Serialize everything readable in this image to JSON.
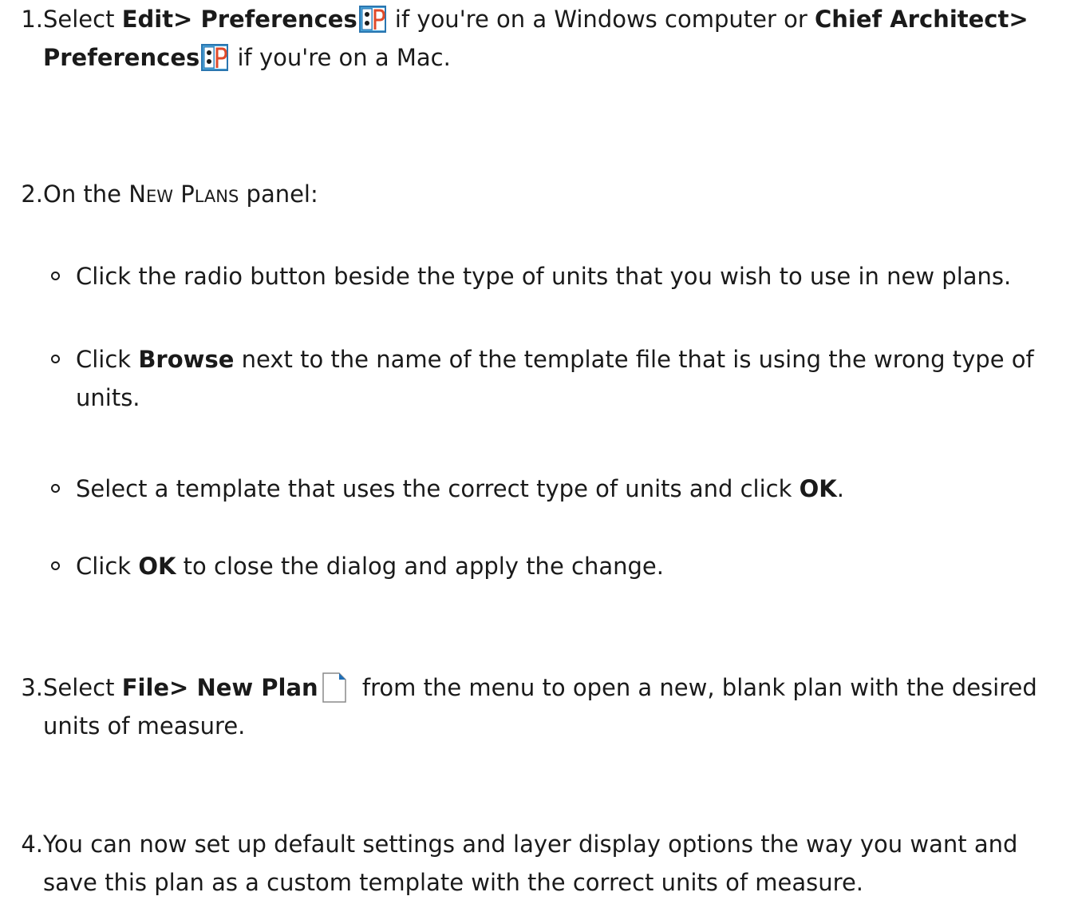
{
  "steps": [
    {
      "num": "1.",
      "pre": "Select ",
      "menu1": "Edit> Preferences",
      "mid1": " if you're on a Windows computer or ",
      "menu2": "Chief Architect> Preferences",
      "post": " if you're on a Mac."
    },
    {
      "num": "2.",
      "pre": "On the ",
      "panel_cap1": "N",
      "panel_small1": "EW",
      "panel_cap2": " P",
      "panel_small2": "LANS",
      "post": " panel:",
      "subitems": [
        {
          "text": "Click the radio button beside the type of units that you wish to use in new plans."
        },
        {
          "pre": "Click ",
          "bold": "Browse",
          "post": " next to the name of the template file that is using the wrong type of units."
        },
        {
          "pre": "Select a template that uses the correct type of units and click ",
          "bold": "OK",
          "post": "."
        },
        {
          "pre": "Click ",
          "bold": "OK",
          "post": " to close the dialog and apply the change."
        }
      ]
    },
    {
      "num": "3.",
      "pre": "Select ",
      "menu": "File> New Plan",
      "post": " from the menu to open a new, blank plan with the desired units of measure."
    },
    {
      "num": "4.",
      "text": "You can now set up default settings and layer display options the way you want and save this plan as a custom template with the correct units of measure."
    }
  ],
  "icons": {
    "preferences": "preferences-icon",
    "new_plan": "new-plan-icon"
  },
  "colors": {
    "text": "#1a1a1a",
    "icon_blue_bg": "#4aa3d8",
    "icon_blue_border": "#2a76b0",
    "icon_red_p": "#e04a2a",
    "icon_file_accent": "#1f6fb8"
  }
}
